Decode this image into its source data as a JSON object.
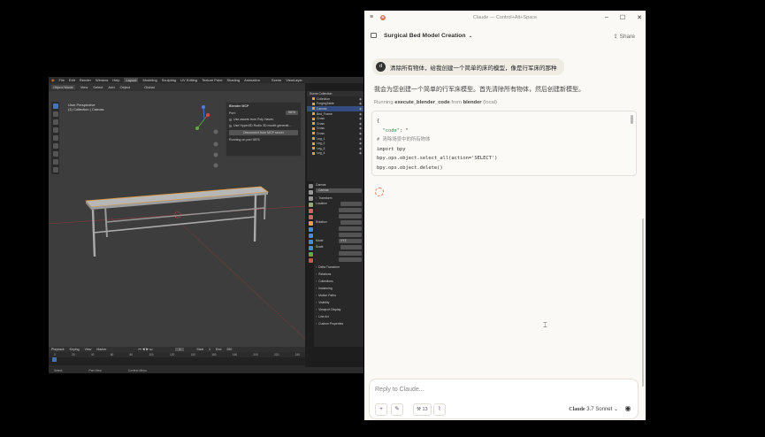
{
  "blender": {
    "menu": [
      "File",
      "Edit",
      "Render",
      "Window",
      "Help"
    ],
    "workspaces": [
      "Layout",
      "Modeling",
      "Sculpting",
      "UV Editing",
      "Texture Paint",
      "Shading",
      "Animation"
    ],
    "active_workspace": "Layout",
    "scene": "Scene",
    "view_layer": "ViewLayer",
    "mode": "Object Mode",
    "header_items": [
      "View",
      "Select",
      "Add",
      "Object"
    ],
    "transform": "Global",
    "viewport": {
      "perspective": "User Perspective",
      "collection": "(1) Collection | Canvas"
    },
    "mcp_panel": {
      "title": "Blender MCP",
      "port_label": "Port:",
      "port_value": "9876",
      "poly_haven": "Use assets from Poly Haven",
      "hyper3d": "Use Hyper3D Rodin 3D model generati...",
      "disconnect": "Disconnect from MCP server",
      "status": "Running on port 9876"
    },
    "outliner": {
      "title": "Scene Collection",
      "items": [
        "Collection",
        "ForgingTable",
        "Canvas",
        "Bed_Frame",
        "Cross",
        "Cross",
        "Cross",
        "Cross",
        "Leg_1",
        "Leg_2",
        "Leg_3",
        "Leg_4"
      ],
      "selected_index": 2
    },
    "properties": {
      "object_name": "Canvas",
      "mesh_name": "Canvas",
      "sections": [
        "Transform",
        "Delta Transform",
        "Relations",
        "Collections",
        "Instancing",
        "Motion Paths",
        "Visibility",
        "Viewport Display",
        "Line Art",
        "Custom Properties"
      ],
      "fields": [
        "Location",
        "Rotation",
        "Scale",
        "Mode"
      ],
      "mode_value": "XYZ"
    },
    "timeline": {
      "menu": [
        "Playback",
        "Keying",
        "View",
        "Marker"
      ],
      "start_label": "Start",
      "start": "1",
      "end_label": "End",
      "end": "250",
      "current": "1",
      "ticks": [
        "0",
        "20",
        "40",
        "60",
        "80",
        "100",
        "120",
        "140",
        "160",
        "180",
        "200",
        "220",
        "240"
      ]
    },
    "status": [
      "Select",
      "Pan View",
      "Context Menu"
    ]
  },
  "claude": {
    "window_title": "Claude — Control+Alt+Space",
    "conversation_title": "Surgical Bed Model Creation",
    "share": "Share",
    "user_avatar": "d",
    "user_message": "清除所有物体，给我创建一个简单的床的模型，像是行军床的那种",
    "assistant_message": "我会为您创建一个简单的行军床模型。首先清除所有物体，然后创建新模型。",
    "tool_prefix": "Running",
    "tool_name": "execute_blender_code",
    "tool_from": "from",
    "tool_source": "blender",
    "tool_suffix": "(local)",
    "code": {
      "line1": "{",
      "line2_key": "  \"code\"",
      "line2_val": ": \"",
      "line3": "# 清除场景中的所有物体",
      "line4": "import bpy",
      "line5": "bpy.ops.object.select_all(action='SELECT')",
      "line6": "bpy.ops.object.delete()"
    },
    "composer_placeholder": "Reply to Claude...",
    "tools_count": "13",
    "model_name": "Claude",
    "model_version": "3.7 Sonnet"
  }
}
